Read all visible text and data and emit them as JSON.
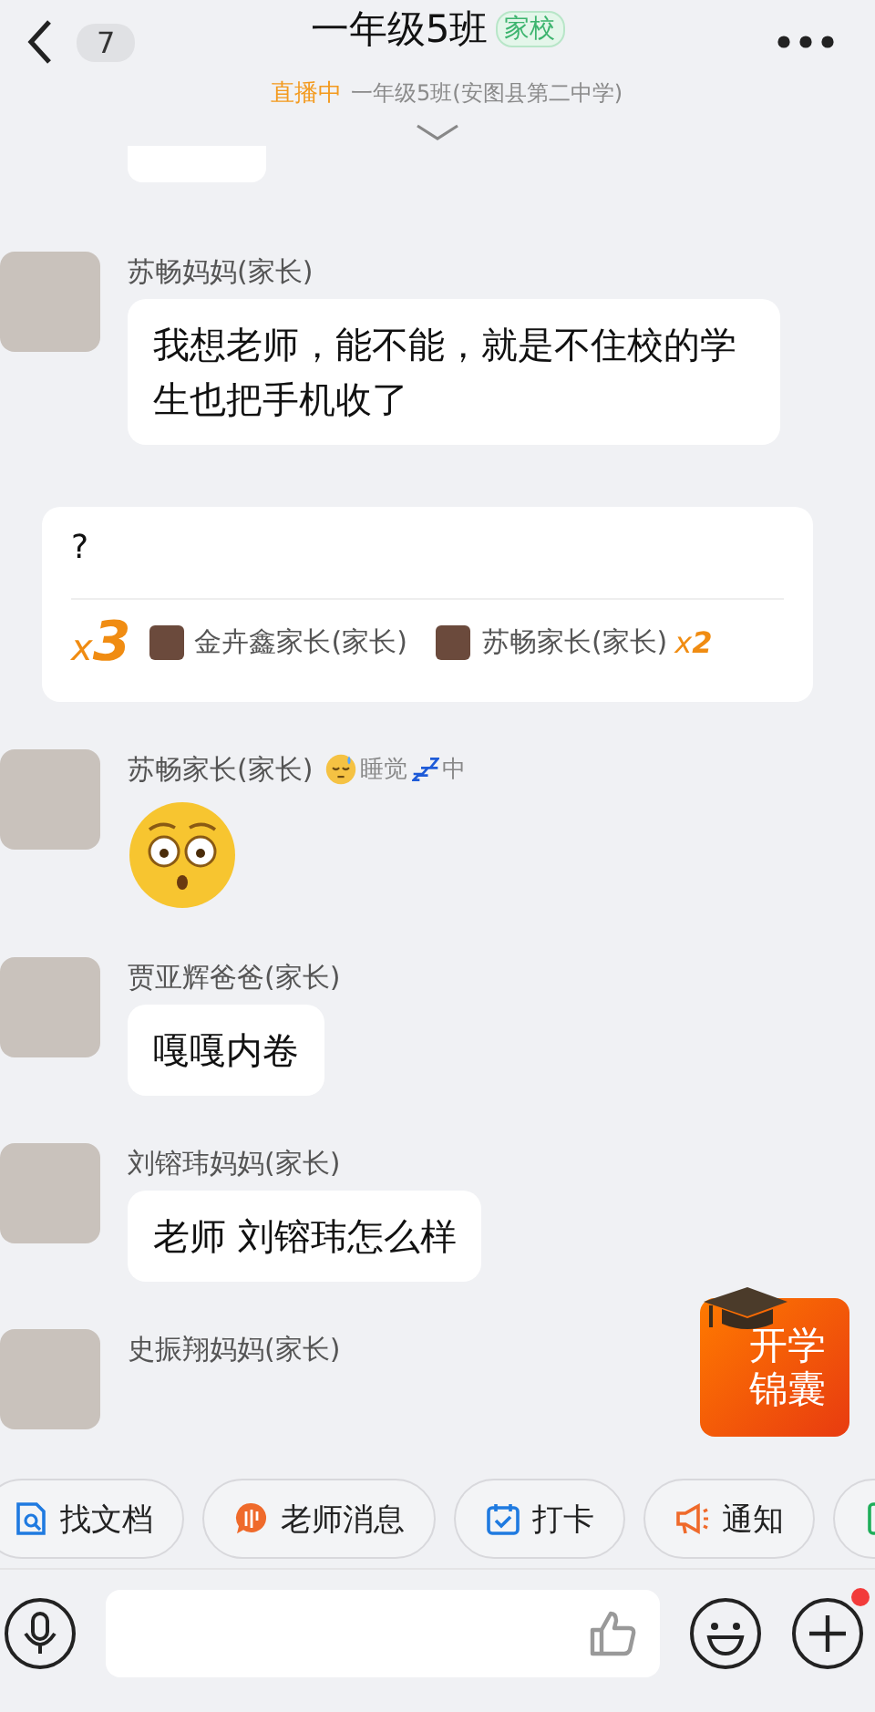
{
  "header": {
    "back_count": "7",
    "title": "一年级5班",
    "tag": "家校",
    "live_label": "直播中",
    "subtitle": "一年级5班(安图县第二中学)"
  },
  "messages": [
    {
      "kind": "text",
      "sender": "苏畅妈妈(家长)",
      "text": "我想老师，能不能，就是不住校的学生也把手机收了"
    },
    {
      "kind": "relay",
      "text": "?",
      "times_mark": "x",
      "count": "3",
      "people": [
        {
          "name": "金卉鑫家长(家长)"
        },
        {
          "name": "苏畅家长(家长)",
          "times_mark": "x",
          "count": "2"
        }
      ]
    },
    {
      "kind": "emoji",
      "sender": "苏畅家长(家长)",
      "status_before": "睡觉",
      "status_after": "中"
    },
    {
      "kind": "text",
      "sender": "贾亚辉爸爸(家长)",
      "text": "嘎嘎内卷"
    },
    {
      "kind": "text",
      "sender": "刘镕玮妈妈(家长)",
      "text": "老师 刘镕玮怎么样"
    },
    {
      "kind": "text",
      "sender": "史振翔妈妈(家长)"
    }
  ],
  "promo": {
    "line1": "开学",
    "line2": "锦囊"
  },
  "quick_actions": [
    {
      "kind": "doc",
      "label": "找文档"
    },
    {
      "kind": "teacher",
      "label": "老师消息"
    },
    {
      "kind": "checkin",
      "label": "打卡"
    },
    {
      "kind": "notice",
      "label": "通知"
    },
    {
      "kind": "note"
    }
  ],
  "input": {
    "has_notification": true
  }
}
